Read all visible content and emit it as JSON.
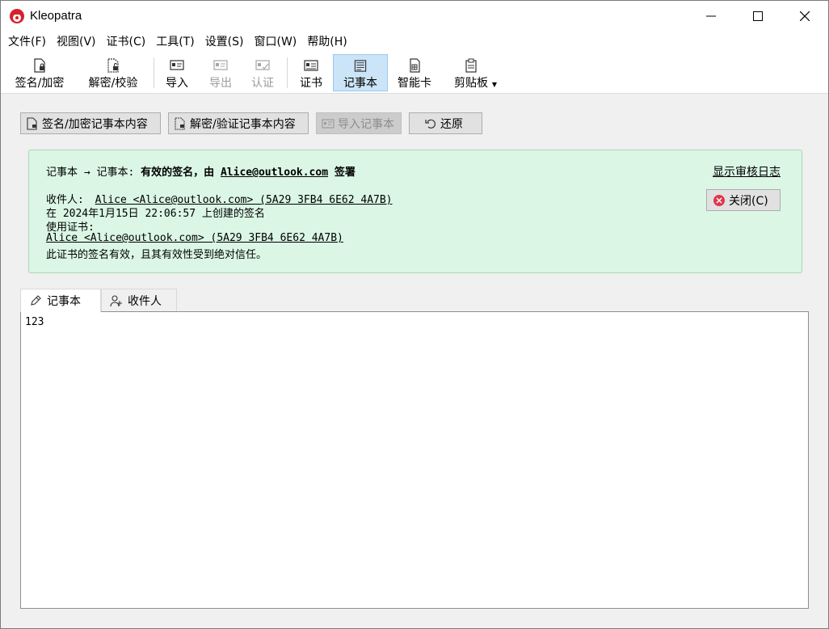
{
  "window": {
    "title": "Kleopatra"
  },
  "menu": [
    "文件(F)",
    "视图(V)",
    "证书(C)",
    "工具(T)",
    "设置(S)",
    "窗口(W)",
    "帮助(H)"
  ],
  "toolbar": {
    "sign_encrypt": "签名/加密",
    "decrypt_verify": "解密/校验",
    "import": "导入",
    "export": "导出",
    "certify": "认证",
    "certificates": "证书",
    "notepad": "记事本",
    "smartcards": "智能卡",
    "clipboard": "剪贴板"
  },
  "actions": {
    "sign_encrypt_notepad": "签名/加密记事本内容",
    "decrypt_verify_notepad": "解密/验证记事本内容",
    "import_notepad": "导入记事本",
    "revert": "还原"
  },
  "message": {
    "header_prefix": "记事本 → 记事本:",
    "header_status": "有效的签名，由",
    "header_signer": "Alice@outlook.com",
    "header_suffix": "签署",
    "recipient_label": "收件人:",
    "recipient_value": "Alice <Alice@outlook.com> (5A29 3FB4 6E62 4A7B)",
    "created_line": "在 2024年1月15日 22:06:57 上创建的签名",
    "cert_label": "使用证书:",
    "cert_value": "Alice <Alice@outlook.com> (5A29 3FB4 6E62 4A7B)",
    "validity": "此证书的签名有效，且其有效性受到绝对信任。",
    "audit_link": "显示审核日志",
    "close_label": "关闭(C)"
  },
  "tabs": [
    "记事本",
    "收件人"
  ],
  "editor": {
    "content": "123"
  },
  "colors": {
    "panel_bg": "#dbf6e5",
    "panel_border": "#a9d6b8",
    "active_tool_bg": "#cce4f7",
    "close_icon": "#e0364a"
  }
}
